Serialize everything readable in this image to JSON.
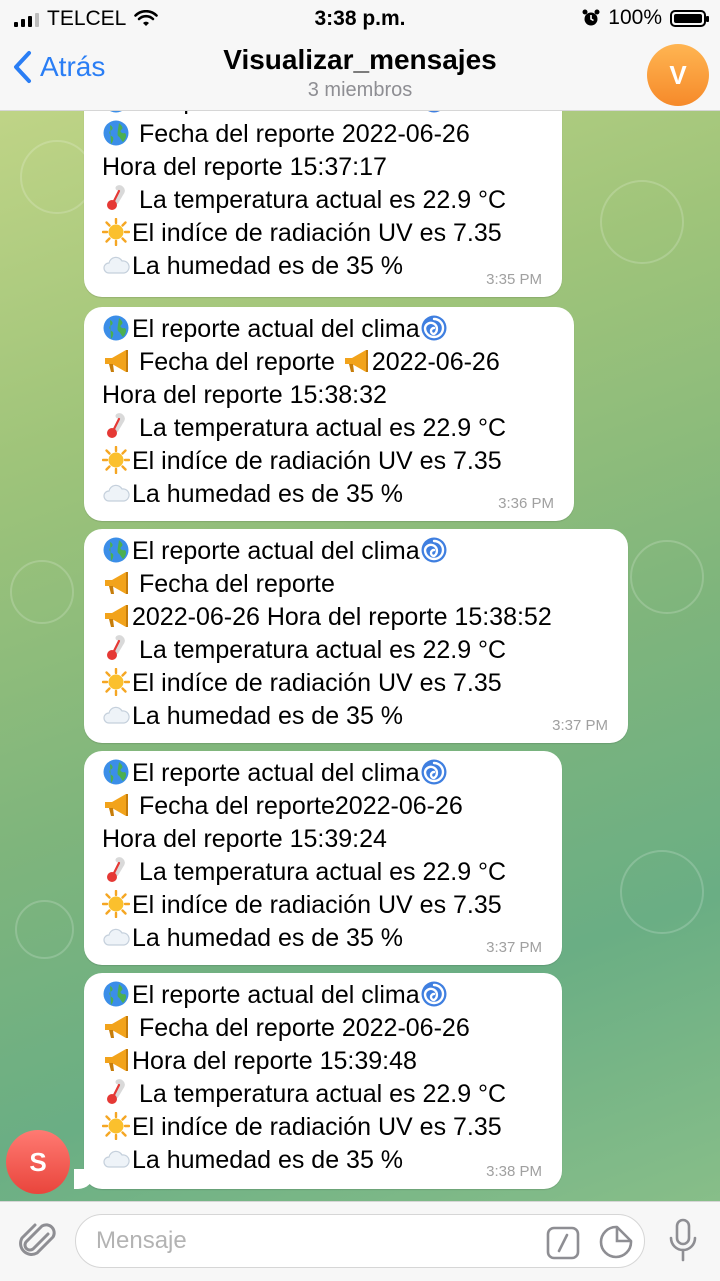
{
  "status_bar": {
    "carrier": "TELCEL",
    "time": "3:38 p.m.",
    "battery": "100%",
    "battery_level": 1.0,
    "signal_bars": 3
  },
  "header": {
    "back_label": "Atrás",
    "title": "Visualizar_mensajes",
    "subtitle": "3 miembros",
    "avatar_initial": "V",
    "avatar_color": "#f68a2a"
  },
  "messages": [
    {
      "lines": [
        {
          "icon": "globe-icon",
          "text": "El reporte actual del clima",
          "trail_icon": "cyclone-icon"
        },
        {
          "icon": "globe-icon",
          "text": " Fecha del reporte 2022-06-26"
        },
        {
          "text": "Hora del reporte 15:37:17"
        },
        {
          "icon": "thermometer-icon",
          "text": " La temperatura actual es 22.9 °C"
        },
        {
          "icon": "sun-icon",
          "text": "El indíce de radiación UV es 7.35"
        },
        {
          "icon": "cloud-icon",
          "text": "La humedad es de 35 %"
        }
      ],
      "time": "3:35 PM"
    },
    {
      "lines": [
        {
          "icon": "globe-icon",
          "text": "El reporte actual del clima",
          "trail_icon": "cyclone-icon"
        },
        {
          "icon": "megaphone-icon",
          "text": " Fecha del reporte ",
          "trail_icon": "megaphone-icon",
          "trail_text": "2022-06-26"
        },
        {
          "text": "Hora del reporte 15:38:32"
        },
        {
          "icon": "thermometer-icon",
          "text": " La temperatura actual es 22.9 °C"
        },
        {
          "icon": "sun-icon",
          "text": "El indíce de radiación UV es 7.35"
        },
        {
          "icon": "cloud-icon",
          "text": "La humedad es de 35 %"
        }
      ],
      "time": "3:36 PM"
    },
    {
      "lines": [
        {
          "icon": "globe-icon",
          "text": "El reporte actual del clima",
          "trail_icon": "cyclone-icon"
        },
        {
          "icon": "megaphone-icon",
          "text": " Fecha del reporte"
        },
        {
          "icon": "megaphone-icon",
          "text": "2022-06-26 Hora del reporte 15:38:52"
        },
        {
          "icon": "thermometer-icon",
          "text": " La temperatura actual es 22.9 °C"
        },
        {
          "icon": "sun-icon",
          "text": "El indíce de radiación UV es 7.35"
        },
        {
          "icon": "cloud-icon",
          "text": "La humedad es de 35 %"
        }
      ],
      "time": "3:37 PM"
    },
    {
      "lines": [
        {
          "icon": "globe-icon",
          "text": "El reporte actual del clima",
          "trail_icon": "cyclone-icon"
        },
        {
          "icon": "megaphone-icon",
          "text": " Fecha del reporte2022-06-26"
        },
        {
          "text": "Hora del reporte 15:39:24"
        },
        {
          "icon": "thermometer-icon",
          "text": " La temperatura actual es 22.9 °C"
        },
        {
          "icon": "sun-icon",
          "text": "El indíce de radiación UV es 7.35"
        },
        {
          "icon": "cloud-icon",
          "text": "La humedad es de 35 %"
        }
      ],
      "time": "3:37 PM"
    },
    {
      "lines": [
        {
          "icon": "globe-icon",
          "text": "El reporte actual del clima",
          "trail_icon": "cyclone-icon"
        },
        {
          "icon": "megaphone-icon",
          "text": " Fecha del reporte 2022-06-26"
        },
        {
          "icon": "megaphone-icon",
          "text": "Hora del reporte 15:39:48"
        },
        {
          "icon": "thermometer-icon",
          "text": " La temperatura actual es 22.9 °C"
        },
        {
          "icon": "sun-icon",
          "text": "El indíce de radiación UV es 7.35"
        },
        {
          "icon": "cloud-icon",
          "text": "La humedad es de 35 %"
        }
      ],
      "time": "3:38 PM"
    }
  ],
  "sender_avatar": {
    "initial": "S",
    "color": "#e9453c"
  },
  "input": {
    "placeholder": "Mensaje"
  }
}
